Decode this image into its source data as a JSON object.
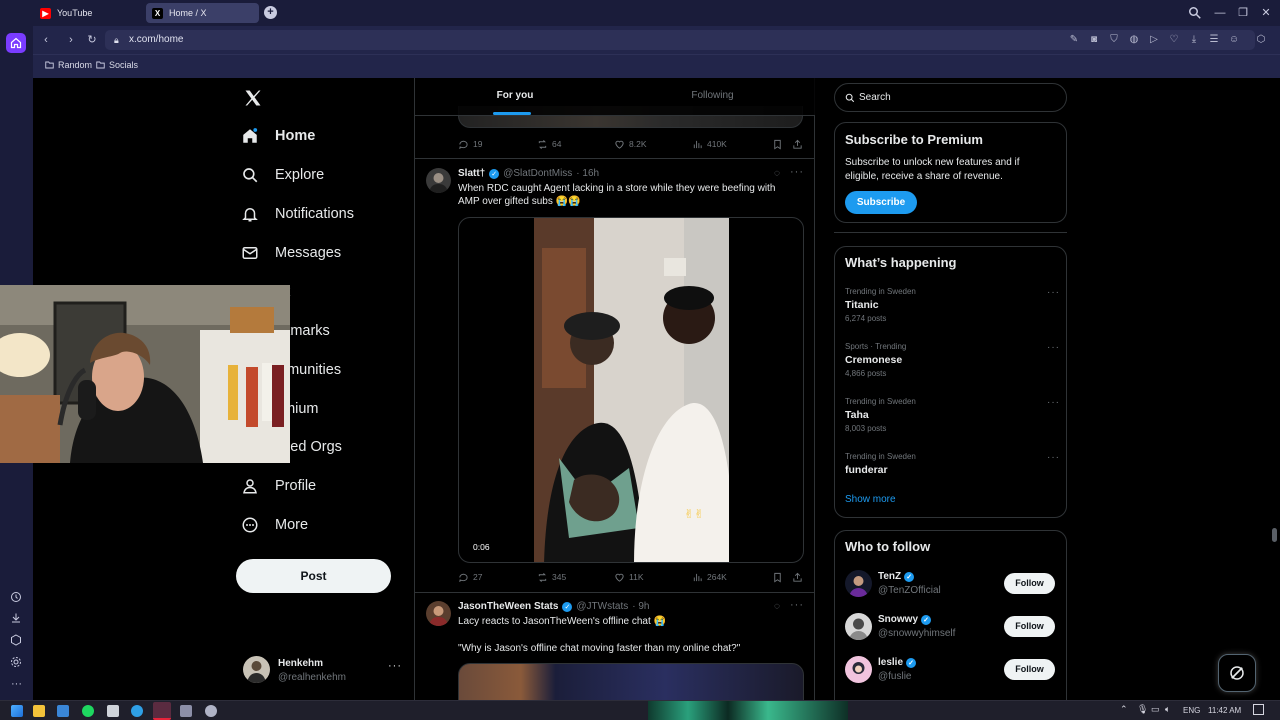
{
  "browser": {
    "tabs": [
      {
        "title": "YouTube"
      },
      {
        "title": "Home / X"
      }
    ],
    "url": "x.com/home",
    "bookmarks": [
      "Random",
      "Socials"
    ]
  },
  "nav": {
    "items": [
      {
        "label": "Home"
      },
      {
        "label": "Explore"
      },
      {
        "label": "Notifications"
      },
      {
        "label": "Messages"
      },
      {
        "label": "ok"
      },
      {
        "label": "okmarks"
      },
      {
        "label": "mmunities"
      },
      {
        "label": "emium"
      },
      {
        "label": "rified Orgs"
      },
      {
        "label": "Profile"
      },
      {
        "label": "More"
      }
    ],
    "post_label": "Post",
    "account": {
      "name": "Henkehm",
      "handle": "@realhenkehm"
    }
  },
  "timeline": {
    "tabs": [
      {
        "label": "For you"
      },
      {
        "label": "Following"
      }
    ],
    "top_tweet_stats": {
      "replies": "19",
      "reposts": "64",
      "likes": "8.2K",
      "views": "410K"
    },
    "tweets": [
      {
        "name": "Slatt†",
        "handle": "@SlatDontMiss",
        "time": "· 16h",
        "text": "When RDC caught Agent lacking in a store while they were beefing with AMP over gifted subs 😭😭",
        "video_time": "0:06",
        "stats": {
          "replies": "27",
          "reposts": "345",
          "likes": "11K",
          "views": "264K"
        }
      },
      {
        "name": "JasonTheWeen Stats",
        "handle": "@JTWstats",
        "time": "· 9h",
        "text": "Lacy reacts to JasonTheWeen's offline chat 😭",
        "text2": "\"Why is Jason's offline chat moving faster than my online chat?\""
      }
    ]
  },
  "sidebar": {
    "search_placeholder": "Search",
    "premium": {
      "title": "Subscribe to Premium",
      "body": "Subscribe to unlock new features and if eligible, receive a share of revenue.",
      "button": "Subscribe"
    },
    "happening": {
      "title": "What’s happening",
      "trends": [
        {
          "meta": "Trending in Sweden",
          "name": "Titanic",
          "count": "6,274 posts"
        },
        {
          "meta": "Sports · Trending",
          "name": "Cremonese",
          "count": "4,866 posts"
        },
        {
          "meta": "Trending in Sweden",
          "name": "Taha",
          "count": "8,003 posts"
        },
        {
          "meta": "Trending in Sweden",
          "name": "funderar",
          "count": ""
        }
      ],
      "show_more": "Show more"
    },
    "who_to_follow": {
      "title": "Who to follow",
      "accounts": [
        {
          "name": "TenZ",
          "handle": "@TenZOfficial",
          "button": "Follow"
        },
        {
          "name": "Snowwy",
          "handle": "@snowwyhimself",
          "button": "Follow"
        },
        {
          "name": "leslie",
          "handle": "@fuslie",
          "button": "Follow"
        }
      ]
    }
  },
  "taskbar": {
    "lang": "ENG",
    "time": "11:42 AM"
  },
  "colors": {
    "accent": "#1d9bf0",
    "chrome": "#1a1c3a",
    "background": "#000000"
  }
}
